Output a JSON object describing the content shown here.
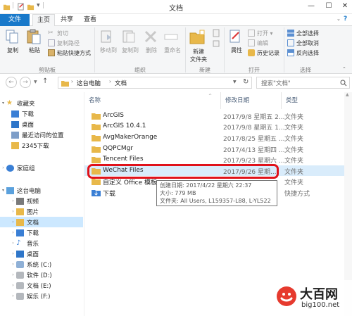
{
  "window": {
    "title": "文档",
    "controls": [
      "—",
      "☐",
      "✕"
    ]
  },
  "ribbon_tabs": [
    "文件",
    "主页",
    "共享",
    "查看"
  ],
  "ribbon": {
    "clipboard": {
      "copy": "复制",
      "paste": "粘贴",
      "cut": "剪切",
      "copy_path": "复制路径",
      "paste_shortcut": "粘贴快捷方式",
      "label": "剪贴板"
    },
    "organize": {
      "move_to": "移动到",
      "copy_to": "复制到",
      "delete": "删除",
      "rename": "重命名",
      "label": "组织"
    },
    "new": {
      "new_folder_line1": "新建",
      "new_folder_line2": "文件夹",
      "label": "新建"
    },
    "open": {
      "properties": "属性",
      "open": "打开 ▾",
      "edit": "编辑",
      "history": "历史记录",
      "label": "打开"
    },
    "select": {
      "select_all": "全部选择",
      "select_none": "全部取消",
      "invert": "反向选择",
      "label": "选择"
    }
  },
  "address": {
    "path": [
      "这台电脑",
      "文档"
    ],
    "search_placeholder": "搜索\"文档\""
  },
  "nav_pane": {
    "favorites": "收藏夹",
    "fav_items": [
      "下载",
      "桌面",
      "最近访问的位置",
      "2345下载"
    ],
    "homegroup": "家庭组",
    "this_pc": "这台电脑",
    "pc_items": [
      "视频",
      "图片",
      "文档",
      "下载",
      "音乐",
      "桌面",
      "系统 (C:)",
      "软件 (D:)",
      "文档 (E:)",
      "娱乐 (F:)"
    ]
  },
  "columns": [
    "名称",
    "修改日期",
    "类型"
  ],
  "files": [
    {
      "name": "ArcGIS",
      "date": "2017/9/8 星期五 2...",
      "type": "文件夹"
    },
    {
      "name": "ArcGIS 10.4.1",
      "date": "2017/9/8 星期五 1...",
      "type": "文件夹"
    },
    {
      "name": "AvgMakerOrange",
      "date": "2017/8/25 星期五 ...",
      "type": "文件夹"
    },
    {
      "name": "QQPCMgr",
      "date": "2017/4/13 星期四 ...",
      "type": "文件夹"
    },
    {
      "name": "Tencent Files",
      "date": "2017/9/23 星期六 ...",
      "type": "文件夹"
    },
    {
      "name": "WeChat Files",
      "date": "2017/9/26 星期...",
      "type": "文件夹"
    },
    {
      "name": "自定义 Office 模板",
      "date": "",
      "type": "文件夹"
    },
    {
      "name": "下载",
      "date": "",
      "type": "快捷方式"
    }
  ],
  "tooltip": {
    "line1": "创建日期: 2017/4/22 星期六 22:37",
    "line2": "大小: 779 MB",
    "line3": "文件夹: All Users, L159357-L88, L-YL522"
  },
  "watermark": {
    "brand": "大百网",
    "url": "big100.net"
  },
  "colors": {
    "file_tab": "#1979ca",
    "selection": "#cce8ff",
    "highlight": "#e0121a",
    "folder": "#e8b84a"
  }
}
